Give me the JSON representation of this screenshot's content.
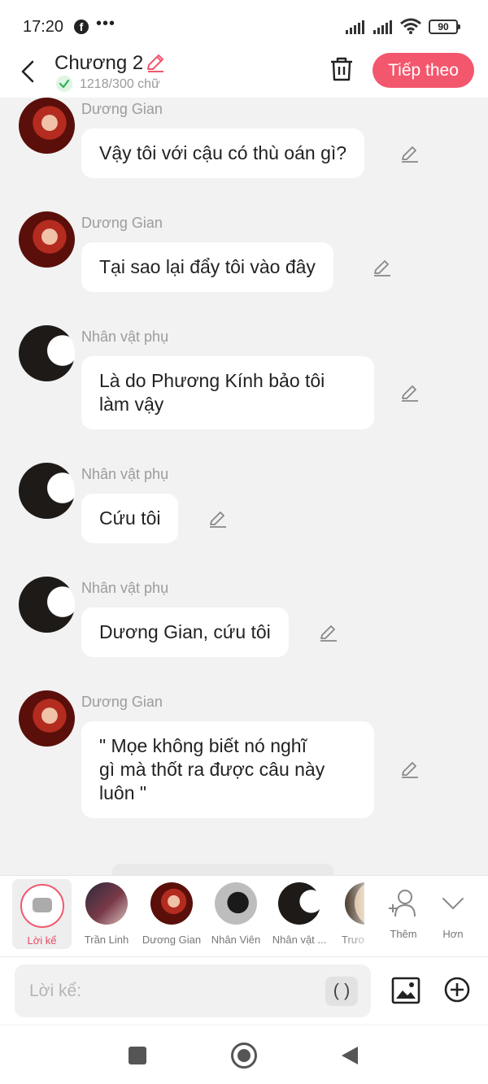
{
  "status_bar": {
    "time": "17:20",
    "battery": "90"
  },
  "header": {
    "title": "Chương 2",
    "word_count": "1218/300 chữ",
    "next_button": "Tiếp theo"
  },
  "messages": [
    {
      "speaker": "Dương Gian",
      "text": "Vậy tôi với cậu có thù oán gì?",
      "avatar": "duong-gian"
    },
    {
      "speaker": "Dương Gian",
      "text": "Tại sao lại đẩy tôi vào đây",
      "avatar": "duong-gian"
    },
    {
      "speaker": "Nhân vật phụ",
      "text_lines": [
        "Là do Phương Kính bảo tôi",
        "làm vậy"
      ],
      "avatar": "nhan-vat-phu"
    },
    {
      "speaker": "Nhân vật phụ",
      "text": "Cứu tôi",
      "avatar": "nhan-vat-phu"
    },
    {
      "speaker": "Nhân vật phụ",
      "text": "Dương Gian, cứu tôi",
      "avatar": "nhan-vat-phu"
    },
    {
      "speaker": "Dương Gian",
      "text_lines": [
        "\" Mọe không biết nó nghĩ",
        "gì mà thốt ra được câu này",
        "luôn \""
      ],
      "avatar": "duong-gian"
    }
  ],
  "characters": {
    "narrator": "Lời kể",
    "items": [
      {
        "label": "Trần Linh"
      },
      {
        "label": "Dương Gian"
      },
      {
        "label": "Nhân Viên"
      },
      {
        "label": "Nhân vật ..."
      },
      {
        "label": "Trươ"
      }
    ],
    "add": "Thêm",
    "more": "Hơn"
  },
  "input": {
    "placeholder": "Lời kể:",
    "paren_button": "( )"
  },
  "colors": {
    "accent": "#f2576d",
    "background": "#f2f2f2",
    "bubble": "#ffffff"
  }
}
